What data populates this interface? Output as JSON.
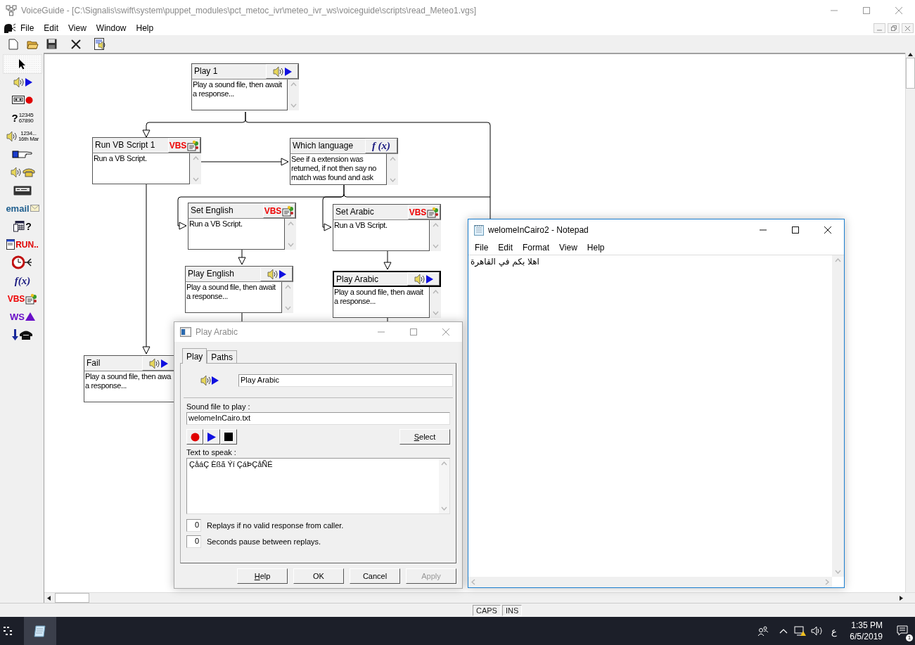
{
  "window": {
    "title": "VoiceGuide - [C:\\Signalis\\swift\\system\\puppet_modules\\pct_metoc_ivr\\meteo_ivr_ws\\voiceguide\\scripts\\read_Meteo1.vgs]",
    "active": false
  },
  "menu": [
    "File",
    "Edit",
    "View",
    "Window",
    "Help"
  ],
  "toolbar": [
    {
      "kind": "new"
    },
    {
      "kind": "open"
    },
    {
      "kind": "save"
    },
    {
      "kind": "delete"
    },
    {
      "kind": "properties"
    }
  ],
  "palette": [
    {
      "kind": "pointer",
      "selected": true
    },
    {
      "kind": "play",
      "selected": false
    },
    {
      "kind": "record",
      "selected": false
    },
    {
      "kind": "digits",
      "text": "?",
      "lines": [
        "12345",
        "67890"
      ],
      "selected": false
    },
    {
      "kind": "say-number",
      "lines": [
        "1234...",
        "16th Mar"
      ],
      "selected": false
    },
    {
      "kind": "transfer",
      "selected": false
    },
    {
      "kind": "phone-play",
      "selected": false
    },
    {
      "kind": "pager",
      "selected": false
    },
    {
      "kind": "email",
      "text": "email",
      "selected": false
    },
    {
      "kind": "query",
      "text": "?",
      "selected": false
    },
    {
      "kind": "run",
      "text": "RUN..",
      "selected": false
    },
    {
      "kind": "timer",
      "selected": false
    },
    {
      "kind": "function",
      "text": "f(x)",
      "selected": false
    },
    {
      "kind": "vbs",
      "text": "VBS",
      "selected": false
    },
    {
      "kind": "webservice",
      "text": "WS",
      "selected": false
    },
    {
      "kind": "hangup",
      "selected": false
    }
  ],
  "nodes": [
    {
      "title": "Play 1",
      "kind": "play",
      "lines": [
        "Play a sound file, then await",
        "a response..."
      ],
      "selected": false
    },
    {
      "title": "Run VB Script 1",
      "kind": "vbs",
      "badge": "VBS",
      "lines": [
        "Run a VB Script."
      ],
      "selected": false
    },
    {
      "title": "Which language",
      "kind": "function",
      "badge": "f (x)",
      "lines": [
        "See if a extension was",
        "returned, if not then say no",
        "match was found and ask"
      ],
      "selected": false
    },
    {
      "title": "Set English",
      "kind": "vbs",
      "badge": "VBS",
      "lines": [
        "Run a VB Script."
      ],
      "selected": false
    },
    {
      "title": "Set Arabic",
      "kind": "vbs",
      "badge": "VBS",
      "lines": [
        "Run a VB Script."
      ],
      "selected": false
    },
    {
      "title": "Play English",
      "kind": "play",
      "lines": [
        "Play a sound file, then await",
        "a response..."
      ],
      "selected": false
    },
    {
      "title": "Play Arabic",
      "kind": "play",
      "lines": [
        "Play a sound file, then await",
        "a response..."
      ],
      "selected": true
    },
    {
      "title": "Fail",
      "kind": "play",
      "lines": [
        "Play a sound file, then awa",
        "a response..."
      ],
      "selected": false
    }
  ],
  "status_bar": [
    "CAPS",
    "INS"
  ],
  "dialog": {
    "title": "Play Arabic",
    "active": false,
    "tabs": [
      {
        "label": "Play",
        "selected": true
      },
      {
        "label": "Paths",
        "selected": false
      }
    ],
    "name_value": "Play Arabic",
    "sound_file": {
      "label": "Sound file to play :",
      "value": "welomeInCairo.txt"
    },
    "transport": [
      {
        "kind": "record"
      },
      {
        "kind": "play"
      },
      {
        "kind": "stop"
      }
    ],
    "select_button": {
      "label": "Select",
      "mnemonic": true
    },
    "text_to_speak": {
      "label": "Text to speak :",
      "value": "ÇåáÇ Èßã Ýí ÇáÞÇåÑÉ"
    },
    "replays": [
      {
        "value": "0",
        "label": "Replays if no valid response from caller."
      },
      {
        "value": "0",
        "label": "Seconds pause between replays."
      }
    ],
    "buttons": [
      {
        "label": "Help",
        "mnemonic": true,
        "disabled": false
      },
      {
        "label": "OK",
        "mnemonic": false,
        "disabled": false
      },
      {
        "label": "Cancel",
        "mnemonic": false,
        "disabled": false
      },
      {
        "label": "Apply",
        "mnemonic": false,
        "disabled": true
      }
    ]
  },
  "notepad": {
    "title": "welomeInCairo2 - Notepad",
    "menu": [
      "File",
      "Edit",
      "Format",
      "View",
      "Help"
    ],
    "text": "اهلا بكم في القاهرة"
  },
  "taskbar": {
    "language": "ع",
    "time": "1:35 PM",
    "date": "6/5/2019",
    "notifications": "1"
  }
}
